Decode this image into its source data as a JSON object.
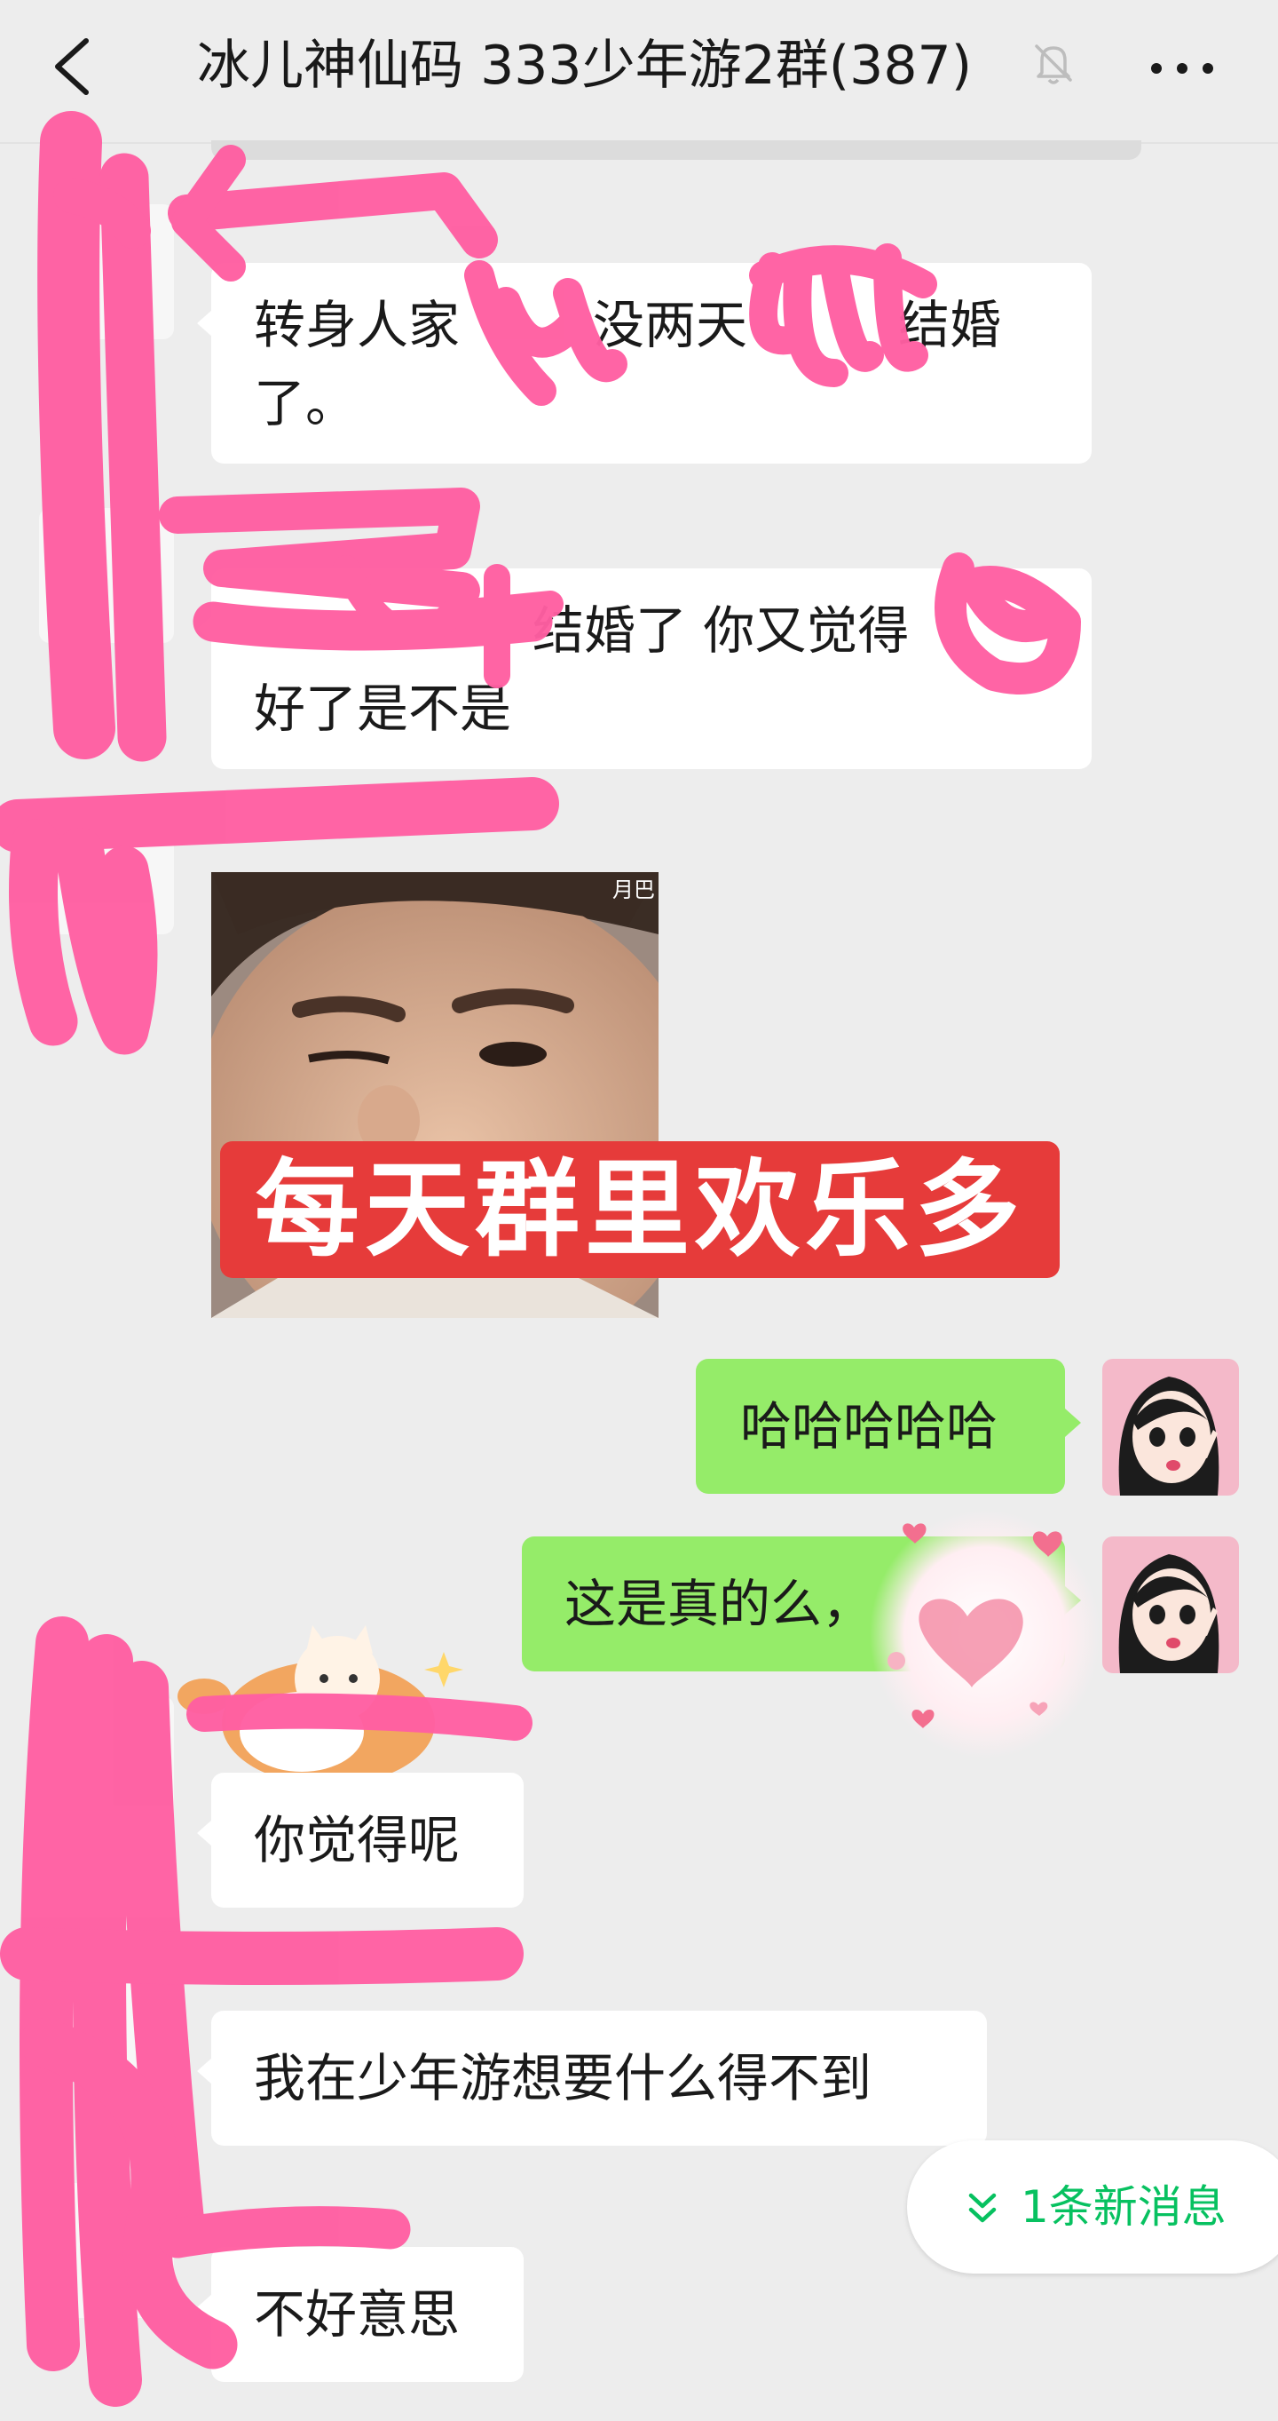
{
  "header": {
    "back_icon": "chevron-left-icon",
    "title": "冰儿神仙码 333少年游2群(387)",
    "mute_icon": "bell-off-icon",
    "more_icon": "ellipsis-icon"
  },
  "messages": [
    {
      "side": "left",
      "line1": "转身人家",
      "line1b": "没两天",
      "line1c": "结婚",
      "line2": "了。"
    },
    {
      "side": "left",
      "line1": "结婚了 你又觉得",
      "line2": "好了是不是"
    },
    {
      "side": "left",
      "type": "sticker",
      "caption": "每天群里欢乐多",
      "tag": "月巴"
    },
    {
      "side": "right",
      "text": "哈哈哈哈哈"
    },
    {
      "side": "right",
      "text": "这是真的么，"
    },
    {
      "side": "left",
      "text": "你觉得呢"
    },
    {
      "side": "left",
      "text": "我在少年游想要什么得不到"
    },
    {
      "side": "left",
      "text": "不好意思"
    }
  ],
  "new_messages": {
    "label": "1条新消息",
    "icon": "double-chevron-down-icon"
  },
  "colors": {
    "background": "#ededed",
    "bubble_incoming": "#ffffff",
    "bubble_outgoing": "#95ec69",
    "accent_green": "#07c160",
    "redaction_pink": "#ff5fa2",
    "sticker_red": "#e63b3a"
  }
}
